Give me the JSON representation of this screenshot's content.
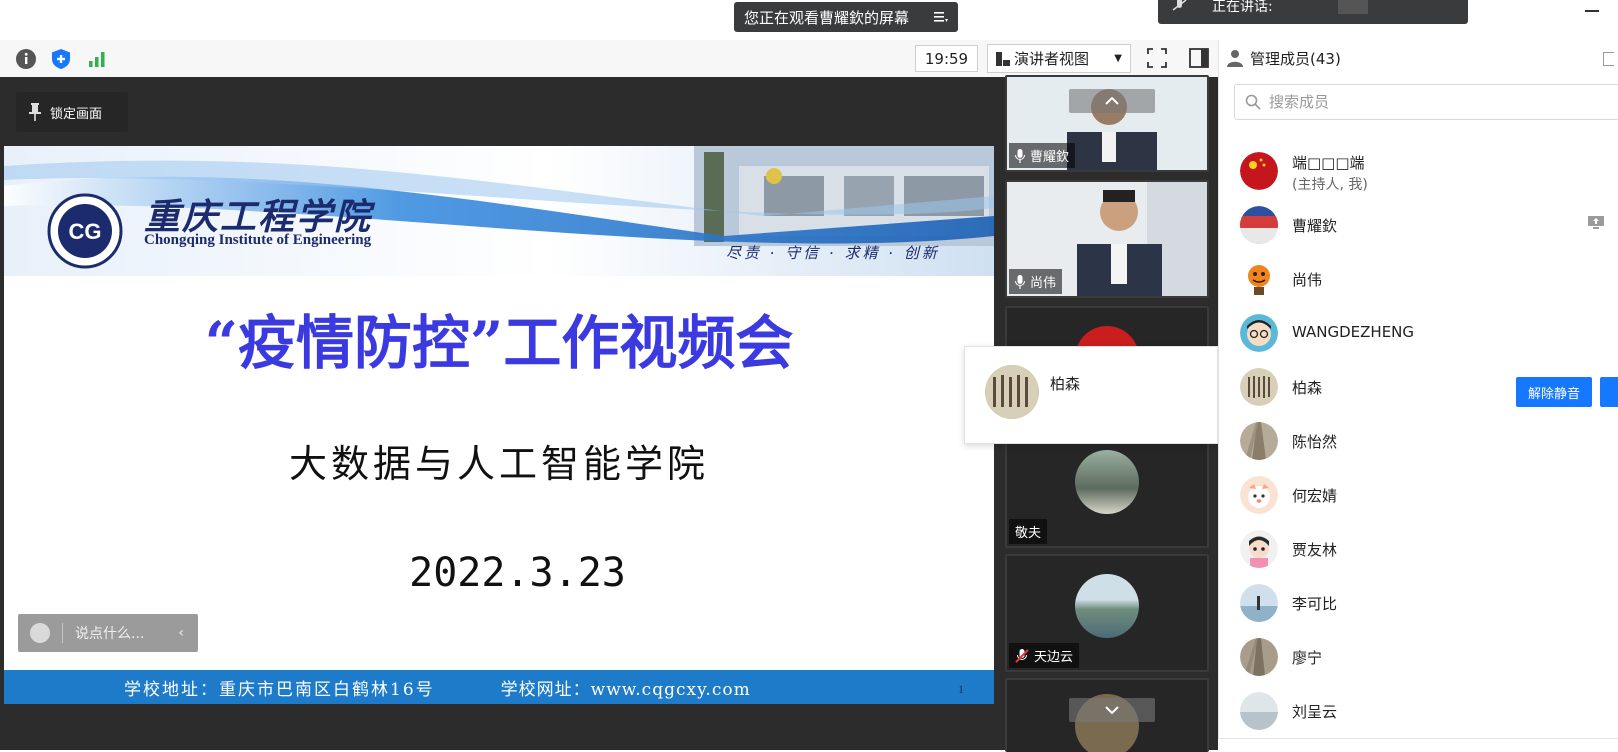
{
  "top_bar": {
    "share_banner": "您正在观看曹耀欽的屏幕",
    "speaking_label": "正在讲话:"
  },
  "toolbar": {
    "timer": "19:59",
    "view_mode": "演讲者视图"
  },
  "stage": {
    "lock_label": "锁定画面",
    "chat_placeholder": "说点什么..."
  },
  "slide": {
    "school_name_cn": "重庆工程学院",
    "school_name_en": "Chongqing Institute of Engineering",
    "motto": "尽责 · 守信 · 求精 · 创新",
    "title": "“疫情防控”工作视频会",
    "subtitle": "大数据与人工智能学院",
    "date": "2022.3.23",
    "footer_address": "学校地址：重庆市巴南区白鹤林16号",
    "footer_website": "学校网址：www.cqgcxy.com",
    "page_number": "1"
  },
  "video_tiles": [
    {
      "name": "曹耀欽",
      "mic": "on"
    },
    {
      "name": "尚伟",
      "mic": "on"
    },
    {
      "name": "",
      "mic": "none"
    },
    {
      "name": "敬夫",
      "mic": "none"
    },
    {
      "name": "天边云",
      "mic": "muted"
    },
    {
      "name": "",
      "mic": "none"
    }
  ],
  "popover": {
    "name": "柏森"
  },
  "panel": {
    "title": "管理成员(43)",
    "search_placeholder": "搜索成员",
    "unmute_label": "解除静音",
    "members": [
      {
        "name": "端□□□端",
        "sub": "(主持人, 我)"
      },
      {
        "name": "曹耀欽",
        "sub": ""
      },
      {
        "name": "尚伟",
        "sub": ""
      },
      {
        "name": "WANGDEZHENG",
        "sub": ""
      },
      {
        "name": "柏森",
        "sub": ""
      },
      {
        "name": "陈怡然",
        "sub": ""
      },
      {
        "name": "何宏婧",
        "sub": ""
      },
      {
        "name": "贾友林",
        "sub": ""
      },
      {
        "name": "李可比",
        "sub": ""
      },
      {
        "name": "廖宁",
        "sub": ""
      },
      {
        "name": "刘呈云",
        "sub": ""
      }
    ]
  },
  "colors": {
    "accent_blue": "#1677ff",
    "slide_title_blue": "#3a3ae0",
    "slide_footer_blue": "#1e7bc9",
    "stage_dark": "#2c2c2c"
  }
}
